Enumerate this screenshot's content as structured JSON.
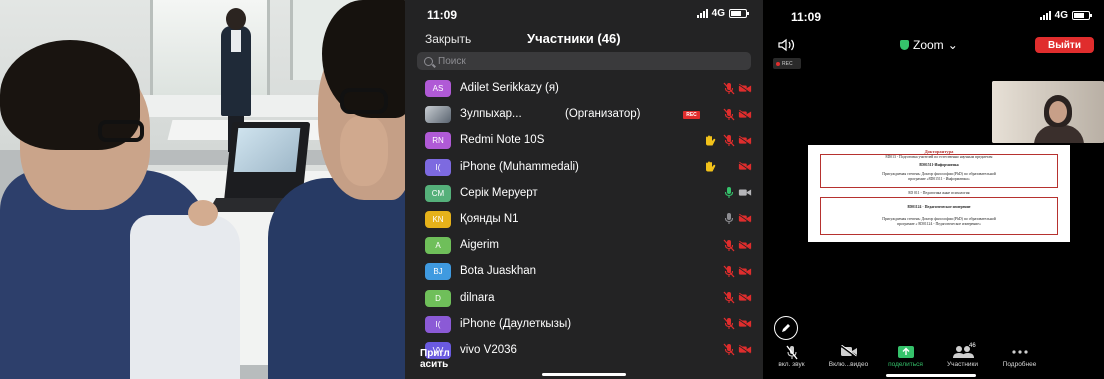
{
  "phone_list": {
    "status_time": "11:09",
    "network": "4G",
    "close_label": "Закрыть",
    "title": "Участники (46)",
    "search_placeholder": "Поиск",
    "invite_label": "Пригл\nасить",
    "participants": [
      {
        "initials": "AS",
        "name": "Adilet Serikkazy (я)",
        "role": "",
        "avatar_color": "#b05ad6",
        "hand": false,
        "mic": "muted",
        "cam": "off"
      },
      {
        "initials": "",
        "name": "Зулпыхар...",
        "role": "(Организатор)",
        "avatar_color": "photo",
        "rec": "REC",
        "hand": false,
        "mic": "muted",
        "cam": "off"
      },
      {
        "initials": "RN",
        "name": "Redmi Note 10S",
        "role": "",
        "avatar_color": "#b05ad6",
        "hand": true,
        "mic": "muted",
        "cam": "off"
      },
      {
        "initials": "I(",
        "name": "iPhone (Muhammedali)",
        "role": "",
        "avatar_color": "#7d6ae0",
        "hand": true,
        "mic": "none",
        "cam": "off"
      },
      {
        "initials": "CM",
        "name": "Серік Меруерт",
        "role": "",
        "avatar_color": "#55b07a",
        "hand": false,
        "mic": "on",
        "cam": "on"
      },
      {
        "initials": "KN",
        "name": "Қоянды N1",
        "role": "",
        "avatar_color": "#e6b21a",
        "hand": false,
        "mic": "gray",
        "cam": "off"
      },
      {
        "initials": "A",
        "name": "Aigerim",
        "role": "",
        "avatar_color": "#6fbf5a",
        "hand": false,
        "mic": "muted",
        "cam": "off"
      },
      {
        "initials": "BJ",
        "name": "Bota Juaskhan",
        "role": "",
        "avatar_color": "#3f9ae0",
        "hand": false,
        "mic": "muted",
        "cam": "off"
      },
      {
        "initials": "D",
        "name": "dilnara",
        "role": "",
        "avatar_color": "#6fbf5a",
        "hand": false,
        "mic": "muted",
        "cam": "off"
      },
      {
        "initials": "I(",
        "name": "iPhone (Даулеткызы)",
        "role": "",
        "avatar_color": "#8b5ad6",
        "hand": false,
        "mic": "muted",
        "cam": "off"
      },
      {
        "initials": "VV",
        "name": "vivo V2036",
        "role": "",
        "avatar_color": "#6a5ae0",
        "hand": false,
        "mic": "muted",
        "cam": "off"
      }
    ]
  },
  "phone_meeting": {
    "status_time": "11:09",
    "network": "4G",
    "app_label": "Zoom",
    "leave_label": "Выйти",
    "rec_label": "REC",
    "slide": {
      "title": "Докторантура",
      "box1_line1": "8D013 - Подготовка учителей по естественно научным предметам",
      "box1_line2": "8D01511-Информатика",
      "box1_line3": "Присуждаемая степень: Доктор философии (PhD) по образовательной",
      "box1_line4": "программе «8D01511 - Информатика»",
      "mid_line": "8D 011 - Педагогика және психология",
      "box2_line1": "8D01124 - Педагогическое измерение",
      "box2_line2": "Присуждаемая степень: Доктор философии (PhD) по образовательной",
      "box2_line3": "программе « 8D01124 - Педагогическое измерение»"
    },
    "toolbar": [
      {
        "label": "вкл. звук",
        "icon": "mic-off-icon"
      },
      {
        "label": "Вклю...видео",
        "icon": "video-off-icon"
      },
      {
        "label": "поделиться",
        "icon": "share-screen-icon"
      },
      {
        "label": "Участники",
        "icon": "participants-icon",
        "count": "46"
      },
      {
        "label": "Подробнее",
        "icon": "more-icon"
      }
    ]
  },
  "colors": {
    "panel_bg": "#232324",
    "muted_red": "#e02d2d",
    "hand_yellow": "#f2c21a",
    "green": "#35c26b"
  }
}
